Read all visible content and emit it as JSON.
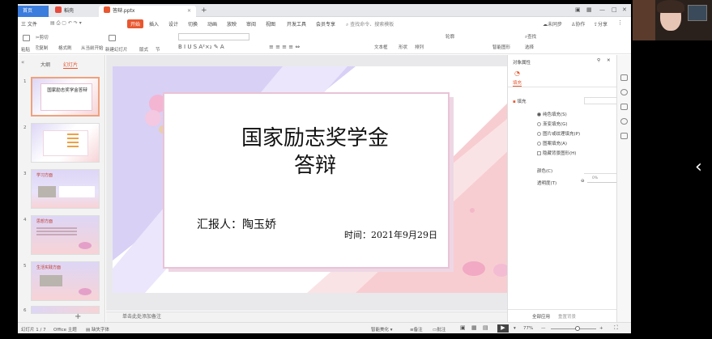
{
  "tabs": {
    "home": "首页",
    "straw": "稻壳",
    "document": "答辩.pptx"
  },
  "menu": [
    "三 文件",
    "开始",
    "插入",
    "设计",
    "切换",
    "动画",
    "放映",
    "审阅",
    "视图",
    "开发工具",
    "会员专享"
  ],
  "menu_active": "开始",
  "search_placeholder": "查找命令、搜索模板",
  "top_right": {
    "unsynced": "未同步",
    "collab": "协作",
    "share": "分享"
  },
  "toolbar": {
    "paste": "粘贴",
    "cut": "剪切",
    "copy": "复制",
    "format_painter": "格式刷",
    "new_slide": "新建幻灯片",
    "layout": "版式",
    "section": "节",
    "redo_from": "从当前开始",
    "text_box": "文本框",
    "shape": "形状",
    "arrange": "排列",
    "outline": "轮廓",
    "smart_art": "智能图形",
    "find": "查找",
    "select": "选择"
  },
  "left_panel": {
    "tabs": [
      "大纲",
      "幻灯片"
    ],
    "active_tab": "幻灯片",
    "slides": [
      {
        "num": "1",
        "title": "国家励志奖学金答辩"
      },
      {
        "num": "2",
        "title": ""
      },
      {
        "num": "3",
        "title": "学习方面"
      },
      {
        "num": "4",
        "title": "思想方面"
      },
      {
        "num": "5",
        "title": "生活实践方面"
      },
      {
        "num": "6",
        "title": ""
      }
    ],
    "add": "+"
  },
  "slide": {
    "title_line1": "国家励志奖学金",
    "title_line2": "答辩",
    "reporter": "汇报人：陶玉娇",
    "time": "时间：2021年9月29日"
  },
  "notes_placeholder": "单击此处添加备注",
  "right_panel": {
    "header": "对象属性",
    "tab": "填充",
    "section": "填充",
    "options": [
      "纯色填充(S)",
      "渐变填充(G)",
      "图片或纹理填充(P)",
      "图案填充(A)",
      "隐藏背景图形(H)"
    ],
    "selected_option": "纯色填充(S)",
    "color_label": "颜色(C)",
    "transparency_label": "透明度(T)",
    "transparency_value": "0%",
    "apply_all": "全部应用",
    "reset": "重置背景"
  },
  "status": {
    "slide_count": "幻灯片 1 / 7",
    "theme": "Office 主题",
    "font_missing": "缺失字体",
    "beautify": "智能美化",
    "notes": "备注",
    "comment": "批注",
    "zoom": "77%"
  },
  "colors": {
    "accent": "#e8572f",
    "slide_lavender": "#d8d0f5",
    "slide_pink": "#f7cdd1",
    "frame": "#eac3d6"
  }
}
